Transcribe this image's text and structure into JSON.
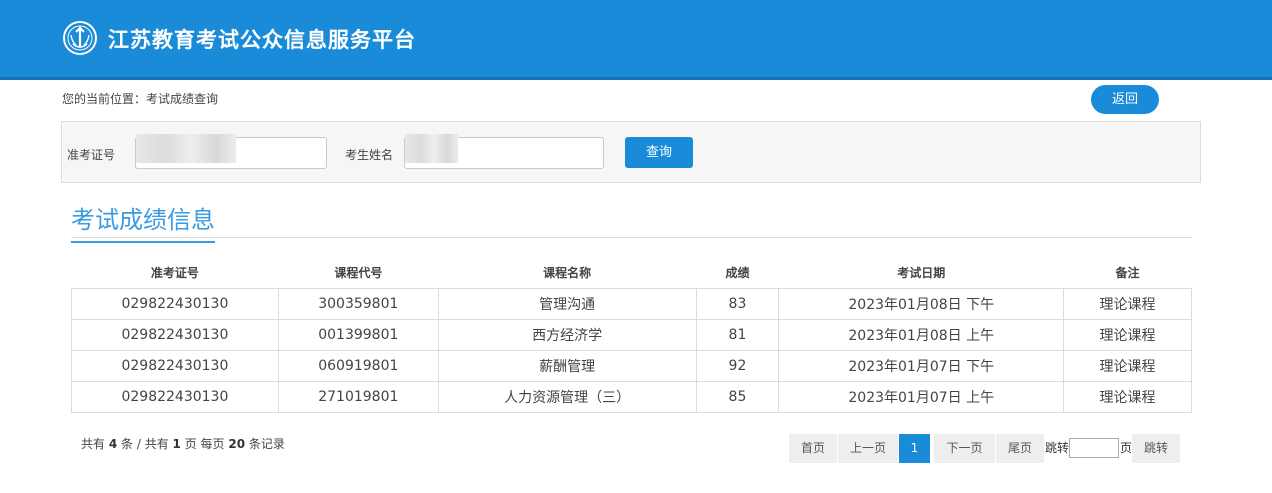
{
  "header": {
    "title": "江苏教育考试公众信息服务平台",
    "logo_icon": "exam-authority-emblem-icon"
  },
  "breadcrumb": "您的当前位置：考试成绩查询",
  "back_label": "返回",
  "search": {
    "ticket_label": "准考证号",
    "ticket_value": "",
    "name_label": "考生姓名",
    "name_value": "",
    "query_label": "查询"
  },
  "section_title": "考试成绩信息",
  "table": {
    "headers": [
      "准考证号",
      "课程代号",
      "课程名称",
      "成绩",
      "考试日期",
      "备注"
    ],
    "rows": [
      [
        "029822430130",
        "300359801",
        "管理沟通",
        "83",
        "2023年01月08日 下午",
        "理论课程"
      ],
      [
        "029822430130",
        "001399801",
        "西方经济学",
        "81",
        "2023年01月08日 上午",
        "理论课程"
      ],
      [
        "029822430130",
        "060919801",
        "薪酬管理",
        "92",
        "2023年01月07日 下午",
        "理论课程"
      ],
      [
        "029822430130",
        "271019801",
        "人力资源管理（三）",
        "85",
        "2023年01月07日 上午",
        "理论课程"
      ]
    ]
  },
  "summary": {
    "prefix": "共有",
    "count": "4",
    "count_unit": "条 / 共有",
    "pages": "1",
    "pages_unit": "页 每页",
    "per_page": "20",
    "per_page_unit": "条记录"
  },
  "pagination": {
    "first": "首页",
    "prev": "上一页",
    "current": "1",
    "next": "下一页",
    "last": "尾页",
    "jump_prefix": "跳转",
    "jump_value": "",
    "jump_suffix": "页",
    "jump_button": "跳转"
  },
  "colors": {
    "brand": "#1a8bd8",
    "section_title": "#3a9be0"
  }
}
